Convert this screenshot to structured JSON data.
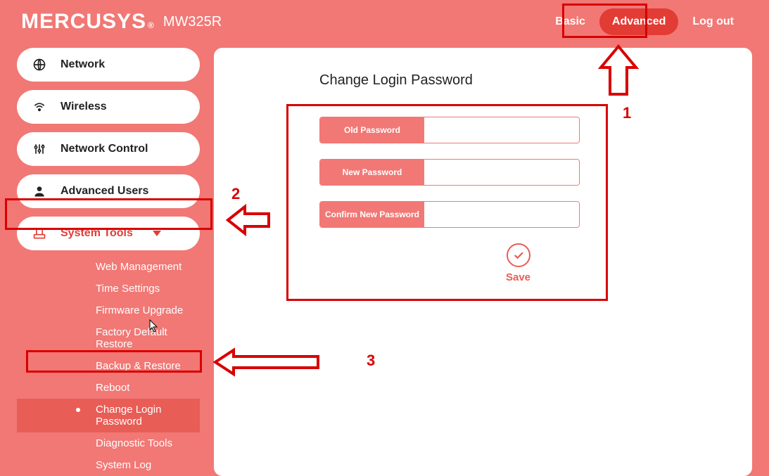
{
  "header": {
    "brand": "MERCUSYS",
    "reg": "®",
    "model": "MW325R",
    "nav_basic": "Basic",
    "nav_advanced": "Advanced",
    "nav_logout": "Log out"
  },
  "sidebar": {
    "items": [
      {
        "label": "Network",
        "icon": "globe-icon"
      },
      {
        "label": "Wireless",
        "icon": "wifi-icon"
      },
      {
        "label": "Network Control",
        "icon": "sliders-icon"
      },
      {
        "label": "Advanced Users",
        "icon": "user-icon"
      },
      {
        "label": "System Tools",
        "icon": "router-icon",
        "active": true
      }
    ],
    "subitems": [
      "Web Management",
      "Time Settings",
      "Firmware Upgrade",
      "Factory Default Restore",
      "Backup & Restore",
      "Reboot",
      "Change Login Password",
      "Diagnostic Tools",
      "System Log"
    ],
    "active_sub_index": 6
  },
  "panel": {
    "title": "Change Login Password",
    "fields": {
      "old_label": "Old Password",
      "old_value": "",
      "new_label": "New Password",
      "new_value": "",
      "confirm_label": "Confirm New Password",
      "confirm_value": ""
    },
    "save_label": "Save"
  },
  "annotations": {
    "n1": "1",
    "n2": "2",
    "n3": "3"
  }
}
